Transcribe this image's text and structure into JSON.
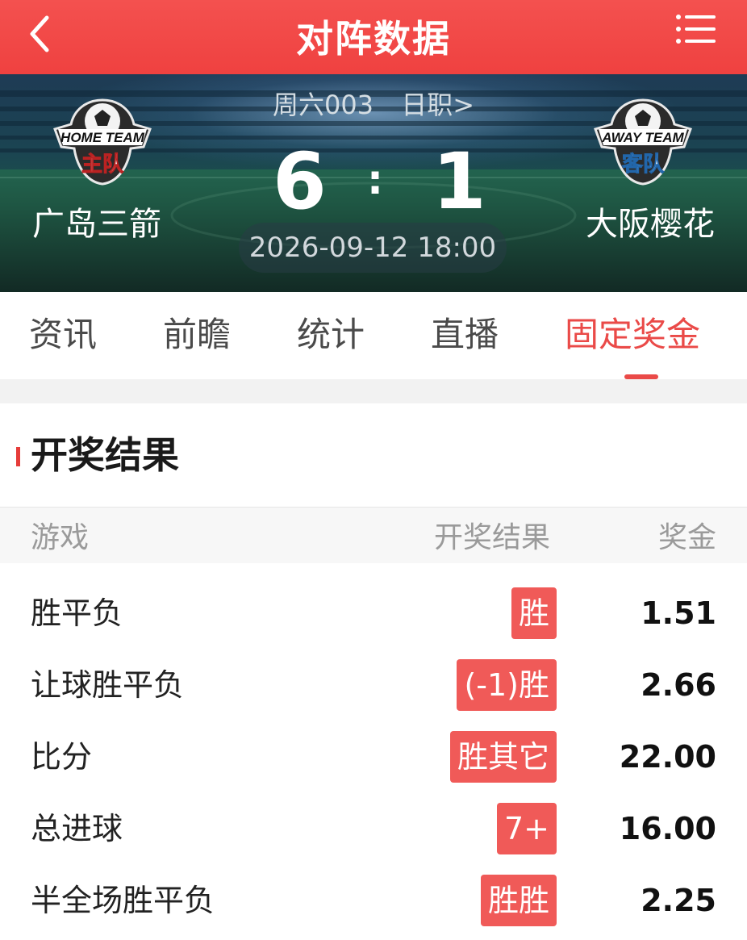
{
  "topbar": {
    "title": "对阵数据",
    "back_icon": "chevron-left-icon",
    "menu_icon": "list-menu-icon"
  },
  "match": {
    "match_no": "周六003",
    "league": "日职>",
    "home": {
      "name": "广岛三箭",
      "logo_text_en": "HOME TEAM",
      "logo_text_cn": "主队",
      "score": "6"
    },
    "away": {
      "name": "大阪樱花",
      "logo_text_en": "AWAY TEAM",
      "logo_text_cn": "客队",
      "score": "1"
    },
    "score_separator": ":",
    "kickoff": "2026-09-12 18:00"
  },
  "tabs": [
    {
      "label": "资讯"
    },
    {
      "label": "前瞻"
    },
    {
      "label": "统计"
    },
    {
      "label": "直播"
    },
    {
      "label": "固定奖金",
      "active": true
    }
  ],
  "section": {
    "title": "开奖结果",
    "columns": {
      "game": "游戏",
      "result": "开奖结果",
      "prize": "奖金"
    },
    "rows": [
      {
        "game": "胜平负",
        "result": "胜",
        "prize": "1.51"
      },
      {
        "game": "让球胜平负",
        "result": "(-1)胜",
        "prize": "2.66"
      },
      {
        "game": "比分",
        "result": "胜其它",
        "prize": "22.00"
      },
      {
        "game": "总进球",
        "result": "7+",
        "prize": "16.00"
      },
      {
        "game": "半全场胜平负",
        "result": "胜胜",
        "prize": "2.25"
      }
    ]
  },
  "colors": {
    "brand_red": "#ef4140",
    "badge_red": "#f05a58",
    "active_tab": "#ea4a48"
  }
}
